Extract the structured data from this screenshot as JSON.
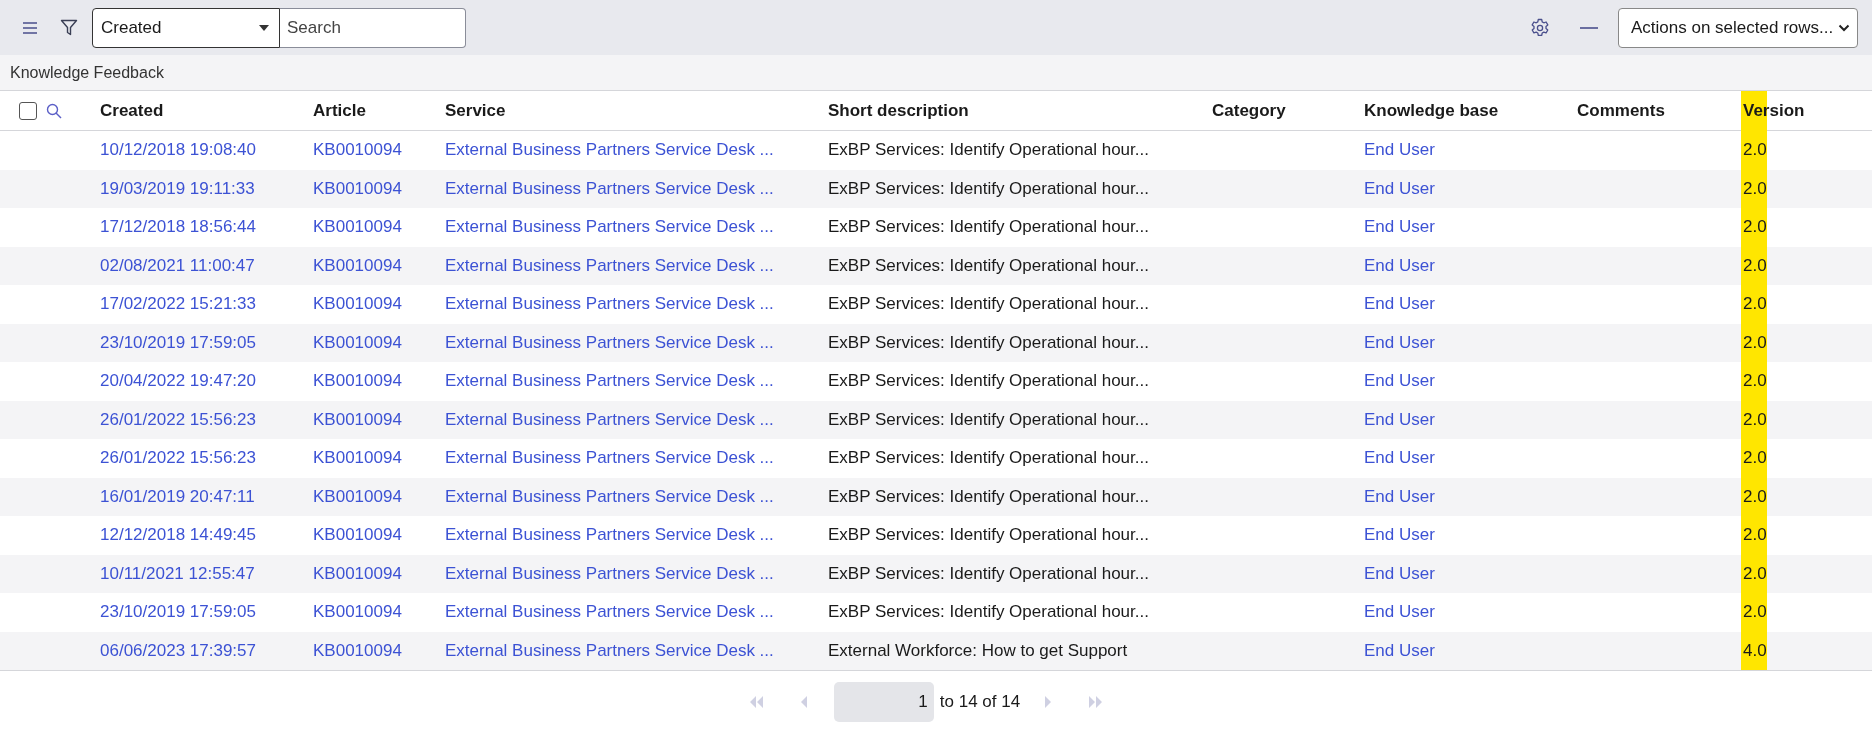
{
  "toolbar": {
    "field_select": "Created",
    "search": {
      "placeholder": "Search"
    },
    "actions_select": "Actions on selected rows..."
  },
  "list_title": "Knowledge Feedback",
  "table": {
    "select_all_checked": false,
    "columns": [
      {
        "label": "Created",
        "highlighted": false
      },
      {
        "label": "Article",
        "highlighted": false
      },
      {
        "label": "Service",
        "highlighted": false
      },
      {
        "label": "Short description",
        "highlighted": false
      },
      {
        "label": "Category",
        "highlighted": false
      },
      {
        "label": "Knowledge base",
        "highlighted": false
      },
      {
        "label": "Comments",
        "highlighted": false
      },
      {
        "label": "Version",
        "highlighted": true
      }
    ],
    "rows": [
      {
        "created": "10/12/2018 19:08:40",
        "article": "KB0010094",
        "service": "External Business Partners Service Desk ...",
        "short_description": "ExBP Services: Identify Operational hour...",
        "knowledge_base": "End User",
        "version": "2.0"
      },
      {
        "created": "19/03/2019 19:11:33",
        "article": "KB0010094",
        "service": "External Business Partners Service Desk ...",
        "short_description": "ExBP Services: Identify Operational hour...",
        "knowledge_base": "End User",
        "version": "2.0"
      },
      {
        "created": "17/12/2018 18:56:44",
        "article": "KB0010094",
        "service": "External Business Partners Service Desk ...",
        "short_description": "ExBP Services: Identify Operational hour...",
        "knowledge_base": "End User",
        "version": "2.0"
      },
      {
        "created": "02/08/2021 11:00:47",
        "article": "KB0010094",
        "service": "External Business Partners Service Desk ...",
        "short_description": "ExBP Services: Identify Operational hour...",
        "knowledge_base": "End User",
        "version": "2.0"
      },
      {
        "created": "17/02/2022 15:21:33",
        "article": "KB0010094",
        "service": "External Business Partners Service Desk ...",
        "short_description": "ExBP Services: Identify Operational hour...",
        "knowledge_base": "End User",
        "version": "2.0"
      },
      {
        "created": "23/10/2019 17:59:05",
        "article": "KB0010094",
        "service": "External Business Partners Service Desk ...",
        "short_description": "ExBP Services: Identify Operational hour...",
        "knowledge_base": "End User",
        "version": "2.0"
      },
      {
        "created": "20/04/2022 19:47:20",
        "article": "KB0010094",
        "service": "External Business Partners Service Desk ...",
        "short_description": "ExBP Services: Identify Operational hour...",
        "knowledge_base": "End User",
        "version": "2.0"
      },
      {
        "created": "26/01/2022 15:56:23",
        "article": "KB0010094",
        "service": "External Business Partners Service Desk ...",
        "short_description": "ExBP Services: Identify Operational hour...",
        "knowledge_base": "End User",
        "version": "2.0"
      },
      {
        "created": "26/01/2022 15:56:23",
        "article": "KB0010094",
        "service": "External Business Partners Service Desk ...",
        "short_description": "ExBP Services: Identify Operational hour...",
        "knowledge_base": "End User",
        "version": "2.0"
      },
      {
        "created": "16/01/2019 20:47:11",
        "article": "KB0010094",
        "service": "External Business Partners Service Desk ...",
        "short_description": "ExBP Services: Identify Operational hour...",
        "knowledge_base": "End User",
        "version": "2.0"
      },
      {
        "created": "12/12/2018 14:49:45",
        "article": "KB0010094",
        "service": "External Business Partners Service Desk ...",
        "short_description": "ExBP Services: Identify Operational hour...",
        "knowledge_base": "End User",
        "version": "2.0"
      },
      {
        "created": "10/11/2021 12:55:47",
        "article": "KB0010094",
        "service": "External Business Partners Service Desk ...",
        "short_description": "ExBP Services: Identify Operational hour...",
        "knowledge_base": "End User",
        "version": "2.0"
      },
      {
        "created": "23/10/2019 17:59:05",
        "article": "KB0010094",
        "service": "External Business Partners Service Desk ...",
        "short_description": "ExBP Services: Identify Operational hour...",
        "knowledge_base": "End User",
        "version": "2.0"
      },
      {
        "created": "06/06/2023 17:39:57",
        "article": "KB0010094",
        "service": "External Business Partners Service Desk ...",
        "short_description": "External Workforce: How to get Support",
        "knowledge_base": "End User",
        "version": "4.0"
      }
    ]
  },
  "pagination": {
    "current": "1",
    "range_text": "to 14 of 14",
    "first_disabled": true,
    "prev_disabled": true,
    "next_disabled": true,
    "last_disabled": true
  }
}
